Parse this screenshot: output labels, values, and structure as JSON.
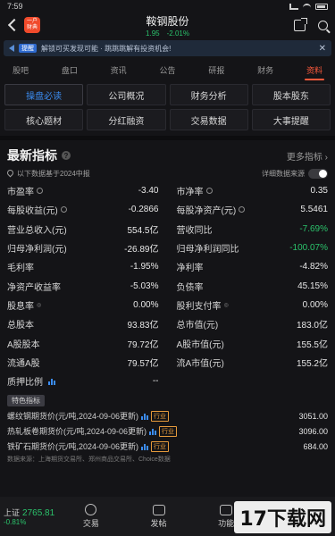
{
  "status": {
    "time": "7:59"
  },
  "header": {
    "logo_lines": [
      "一户",
      "财典"
    ],
    "stock_name": "鞍钢股份",
    "price": "1.95",
    "change": "-2.01%"
  },
  "banner": {
    "tag": "提醒",
    "text": "解锁可买发现可能 · 跳跳跳解有投资机会!"
  },
  "tabs": [
    "股吧",
    "盘口",
    "资讯",
    "公告",
    "研报",
    "财务",
    "资料"
  ],
  "active_tab": 6,
  "subtabs": [
    "操盘必读",
    "公司概况",
    "财务分析",
    "股本股东",
    "核心题材",
    "分红融资",
    "交易数据",
    "大事提醒"
  ],
  "active_subtab": 0,
  "section": {
    "title": "最新指标",
    "more": "更多指标 ›",
    "note": "以下数据基于2024中报",
    "detail_source": "详细数据来源"
  },
  "metrics": [
    [
      {
        "label": "市盈率",
        "value": "-3.40",
        "icon": "info"
      },
      {
        "label": "市净率",
        "value": "0.35",
        "icon": "info"
      }
    ],
    [
      {
        "label": "每股收益(元)",
        "value": "-0.2866",
        "icon": "info"
      },
      {
        "label": "每股净资产(元)",
        "value": "5.5461",
        "icon": "info"
      }
    ],
    [
      {
        "label": "营业总收入(元)",
        "value": "554.5亿"
      },
      {
        "label": "营收同比",
        "value": "-7.69%",
        "color": "green"
      }
    ],
    [
      {
        "label": "归母净利润(元)",
        "value": "-26.89亿"
      },
      {
        "label": "归母净利润同比",
        "value": "-100.07%",
        "color": "green"
      }
    ],
    [
      {
        "label": "毛利率",
        "value": "-1.95%"
      },
      {
        "label": "净利率",
        "value": "-4.82%"
      }
    ],
    [
      {
        "label": "净资产收益率",
        "value": "-5.03%"
      },
      {
        "label": "负债率",
        "value": "45.15%"
      }
    ],
    [
      {
        "label": "股息率",
        "value": "0.00%",
        "icon": "sup"
      },
      {
        "label": "股利支付率",
        "value": "0.00%",
        "icon": "sup"
      }
    ],
    [
      {
        "label": "总股本",
        "value": "93.83亿"
      },
      {
        "label": "总市值(元)",
        "value": "183.0亿"
      }
    ],
    [
      {
        "label": "A股股本",
        "value": "79.72亿"
      },
      {
        "label": "A股市值(元)",
        "value": "155.5亿"
      }
    ],
    [
      {
        "label": "流通A股",
        "value": "79.57亿"
      },
      {
        "label": "流A市值(元)",
        "value": "155.2亿"
      }
    ],
    [
      {
        "label": "质押比例",
        "value": "--",
        "icon": "bars"
      },
      {
        "label": "",
        "value": ""
      }
    ]
  ],
  "special": {
    "tag": "特色指标",
    "industry_tag": "行业",
    "rows": [
      {
        "label": "螺纹钢期货价(元/吨,2024-09-06更新)",
        "value": "3051.00"
      },
      {
        "label": "热轧板卷期货价(元/吨,2024-09-06更新)",
        "value": "3096.00"
      },
      {
        "label": "铁矿石期货价(元/吨,2024-09-06更新)",
        "value": "684.00"
      }
    ],
    "source": "数据来源：上海期货交易所、郑州商品交易所、Choice数据"
  },
  "bottom": {
    "index_name": "上证",
    "index_value": "2765.81",
    "index_change": "-0.81%",
    "items": [
      "交易",
      "发帖",
      "功能"
    ]
  },
  "watermark": "17下载网"
}
